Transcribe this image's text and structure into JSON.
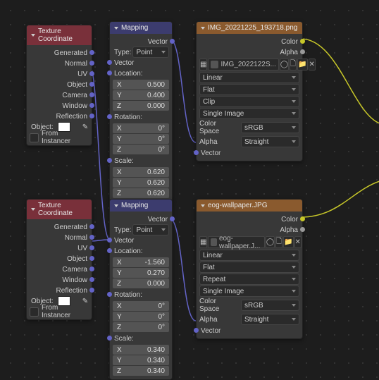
{
  "texcoord": {
    "title": "Texture Coordinate",
    "outputs": [
      "Generated",
      "Normal",
      "UV",
      "Object",
      "Camera",
      "Window",
      "Reflection"
    ],
    "object_label": "Object:",
    "from_instancer": "From Instancer"
  },
  "mapping": {
    "title": "Mapping",
    "vector_out": "Vector",
    "type_label": "Type:",
    "type_value": "Point",
    "vector_in": "Vector",
    "location_label": "Location:",
    "rotation_label": "Rotation:",
    "scale_label": "Scale:",
    "axes": {
      "x": "X",
      "y": "Y",
      "z": "Z"
    }
  },
  "mapping1": {
    "loc": {
      "x": "0.500",
      "y": "0.400",
      "z": "0.000"
    },
    "rot": {
      "x": "0°",
      "y": "0°",
      "z": "0°"
    },
    "scale": {
      "x": "0.620",
      "y": "0.620",
      "z": "0.620"
    }
  },
  "mapping2": {
    "loc": {
      "x": "-1.560",
      "y": "0.270",
      "z": "0.000"
    },
    "rot": {
      "x": "0°",
      "y": "0°",
      "z": "0°"
    },
    "scale": {
      "x": "0.340",
      "y": "0.340",
      "z": "0.340"
    }
  },
  "imgtex": {
    "color_out": "Color",
    "alpha_out": "Alpha",
    "interp": "Linear",
    "proj": "Flat",
    "source": "Single Image",
    "cs_label": "Color Space",
    "alpha_label": "Alpha",
    "vector_in": "Vector",
    "cs_value": "sRGB",
    "alpha_mode": "Straight"
  },
  "imgtex1": {
    "title": "IMG_20221225_193718.png",
    "file": "IMG_2022122S...",
    "ext": "Clip"
  },
  "imgtex2": {
    "title": "eog-wallpaper.JPG",
    "file": "eog-wallpaper.J...",
    "ext": "Repeat"
  },
  "chart_data": null
}
